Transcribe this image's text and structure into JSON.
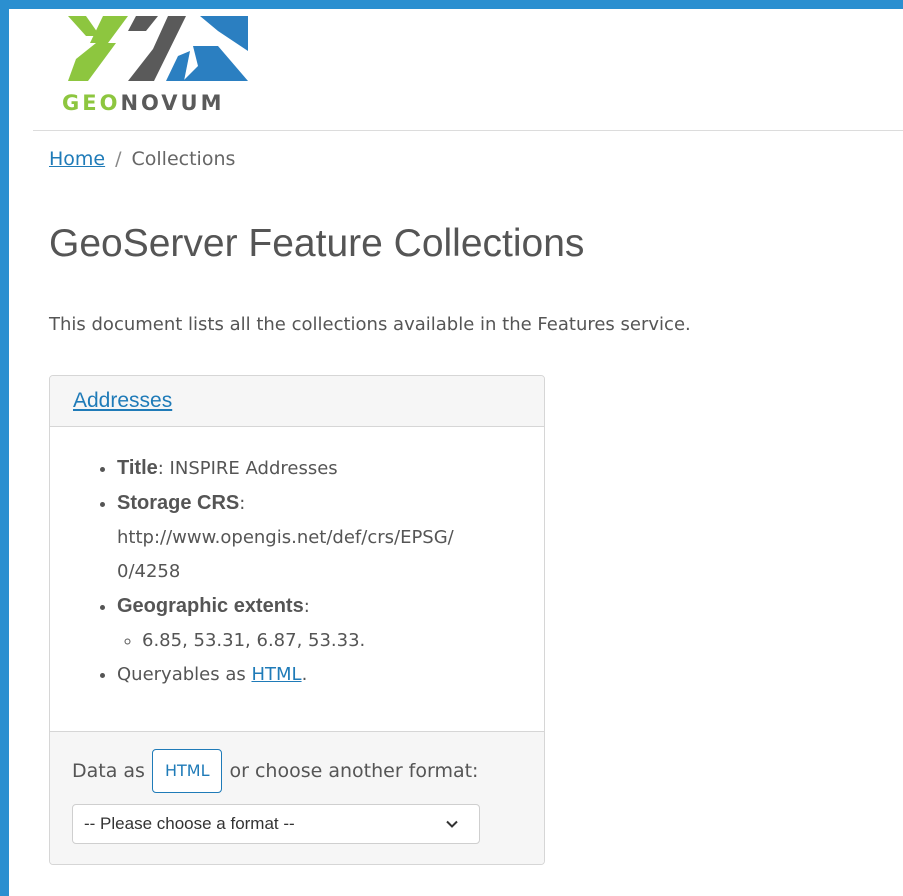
{
  "logo": {
    "text_geo": "GEO",
    "text_novum": "NOVUM",
    "colors": {
      "green": "#8dc63f",
      "gray": "#5a5a5a",
      "blue": "#2b7fc1"
    }
  },
  "breadcrumb": {
    "home": "Home",
    "separator": "/",
    "current": "Collections"
  },
  "page_title": "GeoServer Feature Collections",
  "intro": "This document lists all the collections available in the Features service.",
  "collection": {
    "name": "Addresses",
    "title_label": "Title",
    "title_value": ": INSPIRE Addresses",
    "crs_label": "Storage CRS",
    "crs_value_line1": "http://www.opengis.net/def/crs/EPSG/",
    "crs_value_line2": "0/4258",
    "extents_label": "Geographic extents",
    "extents_value": "6.85, 53.31, 6.87, 53.33.",
    "queryables_prefix": "Queryables as ",
    "queryables_link": "HTML",
    "queryables_suffix": "."
  },
  "footer": {
    "data_as": "Data as",
    "html_button": "HTML",
    "or_choose": "or choose another format:",
    "select_value": "-- Please choose a format --"
  },
  "accent_color": "#2b8fd0",
  "link_color": "#1f7bb8"
}
